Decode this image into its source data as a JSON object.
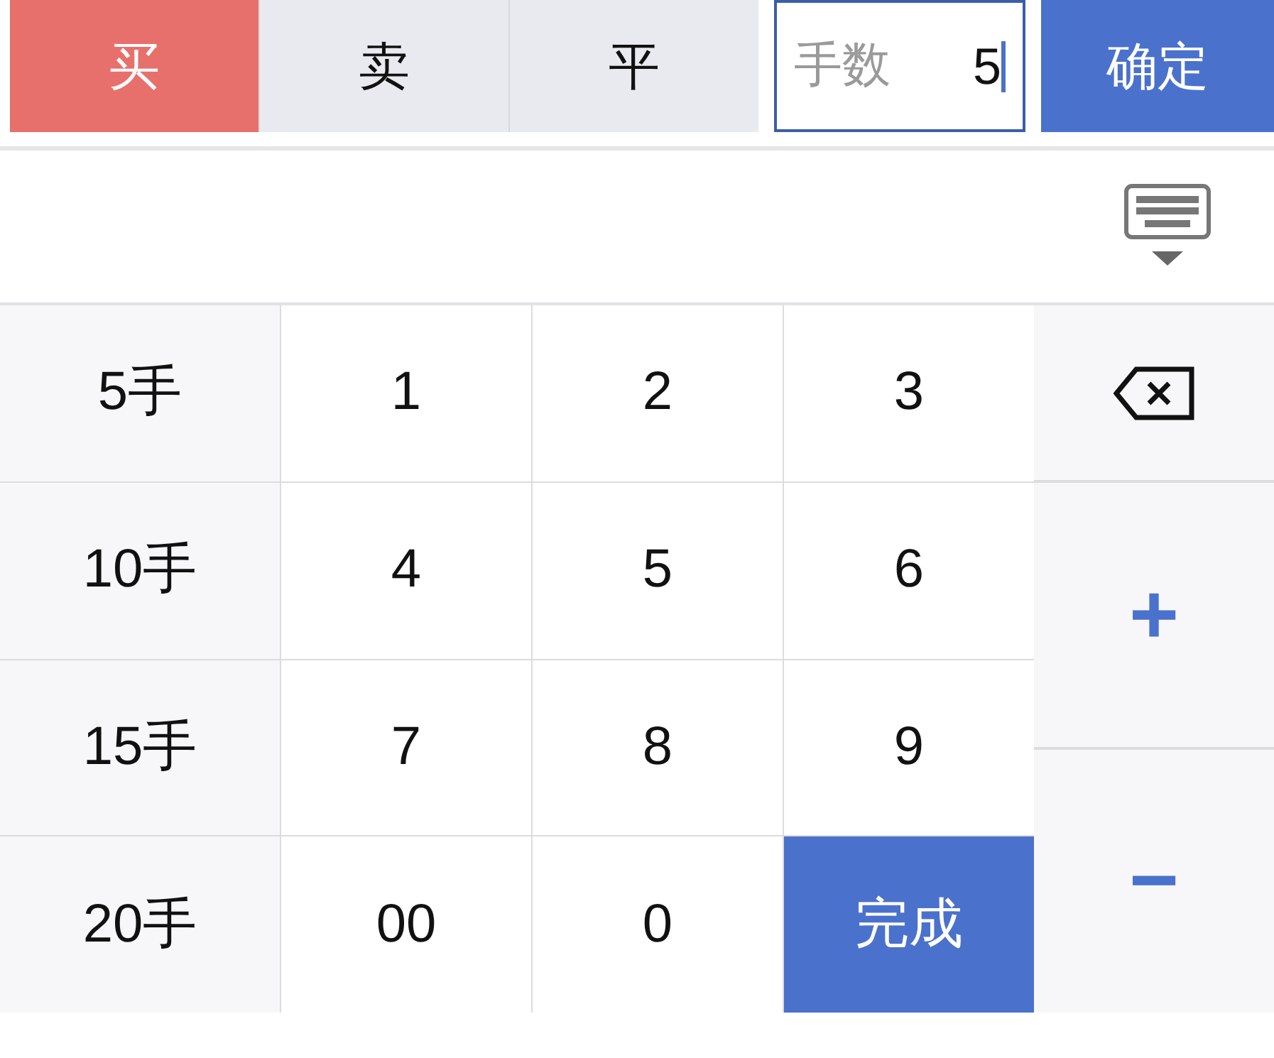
{
  "tabs": [
    {
      "label": "买",
      "selected": true
    },
    {
      "label": "卖",
      "selected": false
    },
    {
      "label": "平",
      "selected": false
    }
  ],
  "quantity_field": {
    "label": "手数",
    "value": "5"
  },
  "confirm_button": "确定",
  "keys": [
    {
      "label": "5手",
      "kind": "quick"
    },
    {
      "label": "1",
      "kind": "digit"
    },
    {
      "label": "2",
      "kind": "digit"
    },
    {
      "label": "3",
      "kind": "digit"
    },
    {
      "label": "10手",
      "kind": "quick"
    },
    {
      "label": "4",
      "kind": "digit"
    },
    {
      "label": "5",
      "kind": "digit"
    },
    {
      "label": "6",
      "kind": "digit"
    },
    {
      "label": "15手",
      "kind": "quick"
    },
    {
      "label": "7",
      "kind": "digit"
    },
    {
      "label": "8",
      "kind": "digit"
    },
    {
      "label": "9",
      "kind": "digit"
    },
    {
      "label": "20手",
      "kind": "quick"
    },
    {
      "label": "00",
      "kind": "digit"
    },
    {
      "label": "0",
      "kind": "digit"
    },
    {
      "label": "完成",
      "kind": "done"
    }
  ],
  "side_keys": [
    {
      "kind": "backspace"
    },
    {
      "kind": "step",
      "label": "+"
    },
    {
      "kind": "step",
      "label": "−"
    }
  ]
}
